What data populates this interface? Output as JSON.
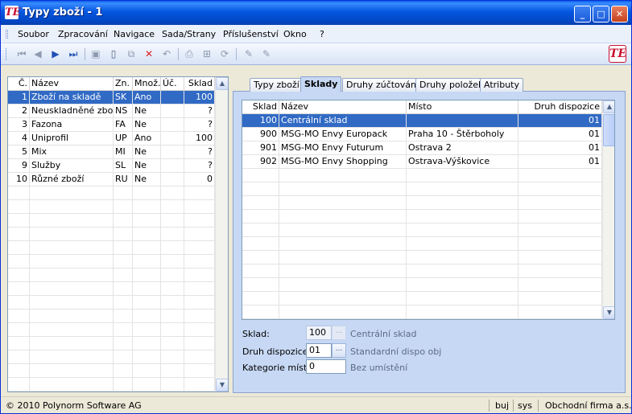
{
  "window": {
    "title": "Typy zboží - 1",
    "logo": "TE",
    "minimize": "_",
    "maximize": "□",
    "close": "✕"
  },
  "menu": [
    "Soubor",
    "Zpracování",
    "Navigace",
    "Sada/Strany",
    "Příslušenství",
    "Okno",
    "?"
  ],
  "toolbar": {
    "icons": [
      "first-record-icon",
      "prev-record-icon",
      "next-record-icon",
      "last-record-icon",
      "save-icon",
      "new-icon",
      "copy-icon",
      "delete-icon",
      "undo-icon",
      "print-icon",
      "tree-icon",
      "refresh-icon",
      "edit-icon",
      "edit-alt-icon"
    ],
    "logo": "TE"
  },
  "left_grid": {
    "columns": [
      "Č.",
      "Název",
      "Zn.",
      "Množ.",
      "Úč.",
      "Sklad"
    ],
    "rows": [
      [
        "1",
        "Zboží na skladě",
        "SK",
        "Ano",
        "",
        "100"
      ],
      [
        "2",
        "Neuskladněné zboží",
        "NS",
        "Ne",
        "",
        "?"
      ],
      [
        "3",
        "Fazona",
        "FA",
        "Ne",
        "",
        "?"
      ],
      [
        "4",
        "Uniprofil",
        "UP",
        "Ano",
        "",
        "100"
      ],
      [
        "5",
        "Mix",
        "MI",
        "Ne",
        "",
        "?"
      ],
      [
        "9",
        "Služby",
        "SL",
        "Ne",
        "",
        "?"
      ],
      [
        "10",
        "Různé zboží",
        "RU",
        "Ne",
        "",
        "0"
      ]
    ],
    "selected_row": 0
  },
  "tabs": [
    "Typy zboží",
    "Sklady",
    "Druhy zúčtování",
    "Druhy položek",
    "Atributy"
  ],
  "active_tab": 1,
  "right_grid": {
    "columns": [
      "Sklad",
      "Název",
      "Místo",
      "Druh dispozice"
    ],
    "rows": [
      [
        "100",
        "Centrální sklad",
        "",
        "01"
      ],
      [
        "900",
        "MSG-MO Envy Europack",
        "Praha 10 - Štěrboholy",
        "01"
      ],
      [
        "901",
        "MSG-MO Envy Futurum",
        "Ostrava 2",
        "01"
      ],
      [
        "902",
        "MSG-MO Envy Shopping",
        "Ostrava-Výškovice",
        "01"
      ]
    ],
    "selected_row": 0
  },
  "form": {
    "sklad": {
      "label": "Sklad:",
      "value": "100",
      "desc": "Centrální sklad"
    },
    "druh": {
      "label": "Druh dispozice:",
      "value": "01",
      "desc": "Standardní dispo obj"
    },
    "kategorie": {
      "label": "Kategorie místa:",
      "value": "0",
      "desc": "Bez umístění"
    },
    "browse": "..."
  },
  "status": {
    "copyright": "© 2010 Polynorm Software AG",
    "user": "buj",
    "db": "sys",
    "company": "Obchodní firma a.s."
  },
  "colors": {
    "titlebar": "#0456E0",
    "selection": "#316AC5",
    "panel": "#C7D8F4",
    "delete": "#E02020"
  }
}
